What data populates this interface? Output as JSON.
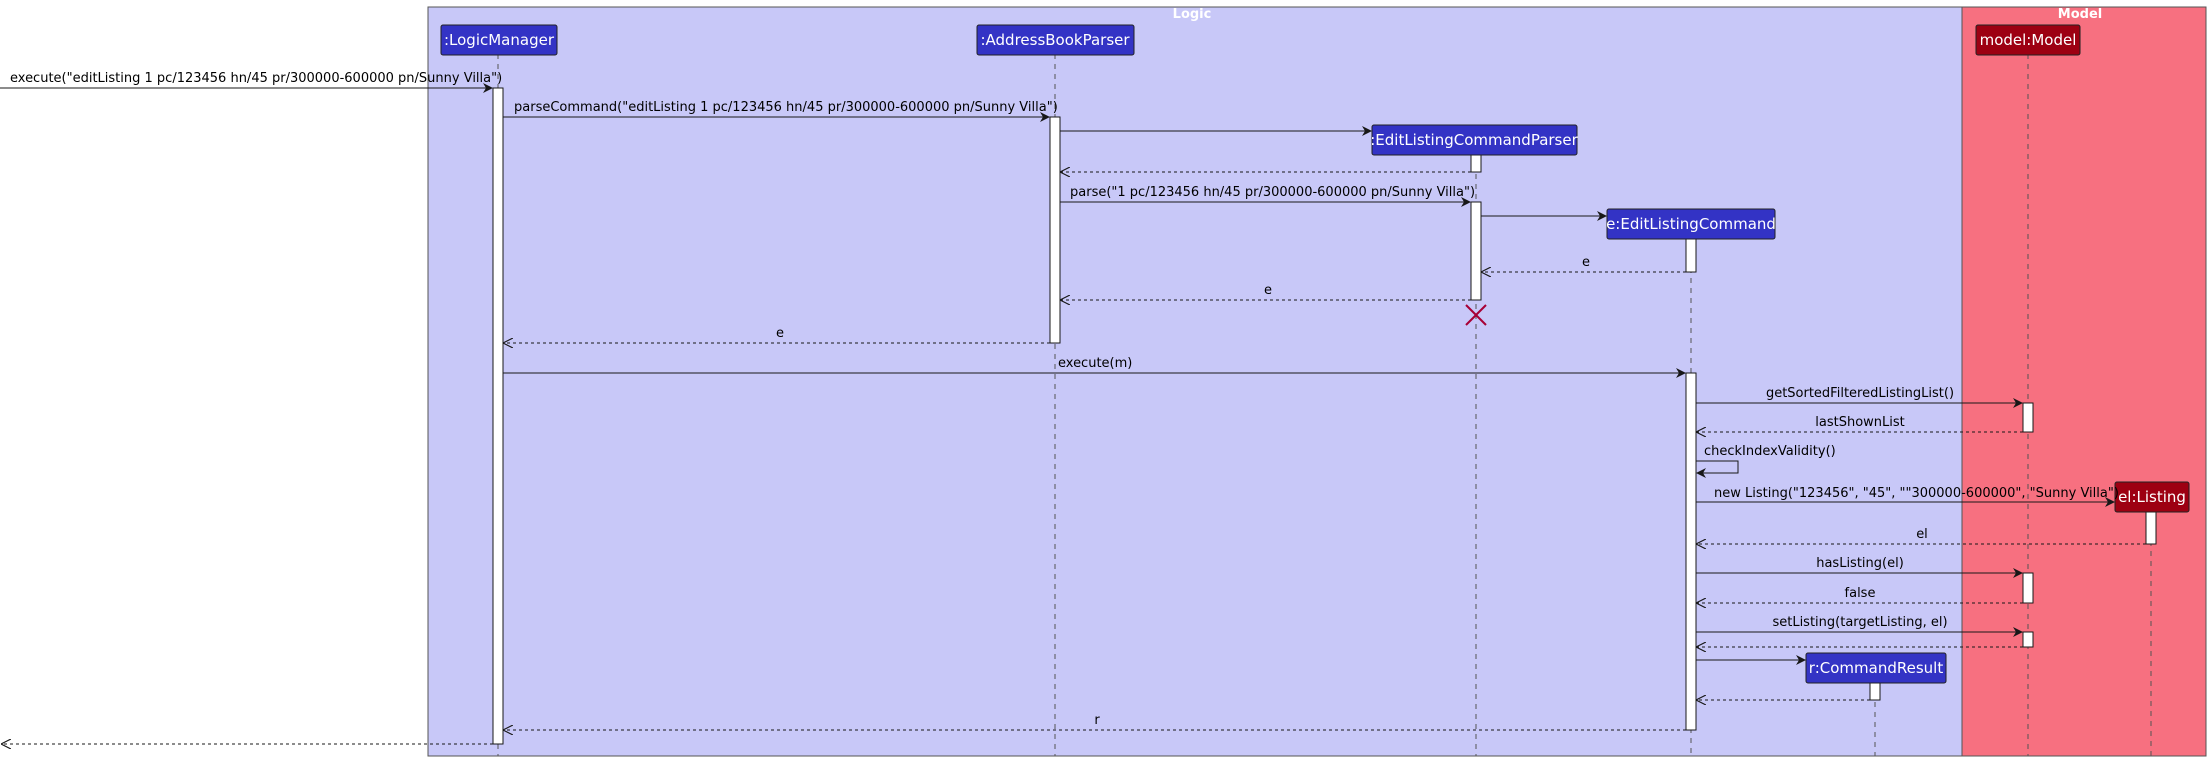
{
  "groups": [
    {
      "id": "logic",
      "title": "Logic",
      "fill": "#C8C8F8"
    },
    {
      "id": "model",
      "title": "Model",
      "fill": "#F77080"
    }
  ],
  "participants": [
    {
      "id": "lm",
      "label": ":LogicManager",
      "color": "#3333C5"
    },
    {
      "id": "abp",
      "label": ":AddressBookParser",
      "color": "#3333C5"
    },
    {
      "id": "elcp",
      "label": ":EditListingCommandParser",
      "color": "#3333C5"
    },
    {
      "id": "elc",
      "label": "e:EditListingCommand",
      "color": "#3333C5"
    },
    {
      "id": "cr",
      "label": "r:CommandResult",
      "color": "#3333C5"
    },
    {
      "id": "model",
      "label": "model:Model",
      "color": "#9D0012"
    },
    {
      "id": "el",
      "label": "el:Listing",
      "color": "#9D0012"
    }
  ],
  "messages": [
    {
      "label": "execute(\"editListing 1 pc/123456 hn/45 pr/300000-600000 pn/Sunny Villa\")",
      "dashed": false
    },
    {
      "label": "parseCommand(\"editListing 1 pc/123456 hn/45 pr/300000-600000 pn/Sunny Villa\")",
      "dashed": false
    },
    {
      "label": "",
      "dashed": false
    },
    {
      "label": "",
      "dashed": true
    },
    {
      "label": "parse(\"1 pc/123456 hn/45 pr/300000-600000 pn/Sunny Villa\")",
      "dashed": false
    },
    {
      "label": "",
      "dashed": false
    },
    {
      "label": "e",
      "dashed": true
    },
    {
      "label": "e",
      "dashed": true
    },
    {
      "label": "e",
      "dashed": true
    },
    {
      "label": "execute(m)",
      "dashed": false
    },
    {
      "label": "getSortedFilteredListingList()",
      "dashed": false
    },
    {
      "label": "lastShownList",
      "dashed": true
    },
    {
      "label": "checkIndexValidity()",
      "dashed": false
    },
    {
      "label": "new Listing(\"123456\", \"45\", \"\"300000-600000\", \"Sunny Villa\")",
      "dashed": false
    },
    {
      "label": "el",
      "dashed": true
    },
    {
      "label": "hasListing(el)",
      "dashed": false
    },
    {
      "label": "false",
      "dashed": true
    },
    {
      "label": "setListing(targetListing, el)",
      "dashed": false
    },
    {
      "label": "",
      "dashed": true
    },
    {
      "label": "",
      "dashed": false
    },
    {
      "label": "",
      "dashed": true
    },
    {
      "label": "r",
      "dashed": true
    },
    {
      "label": "",
      "dashed": true
    }
  ]
}
